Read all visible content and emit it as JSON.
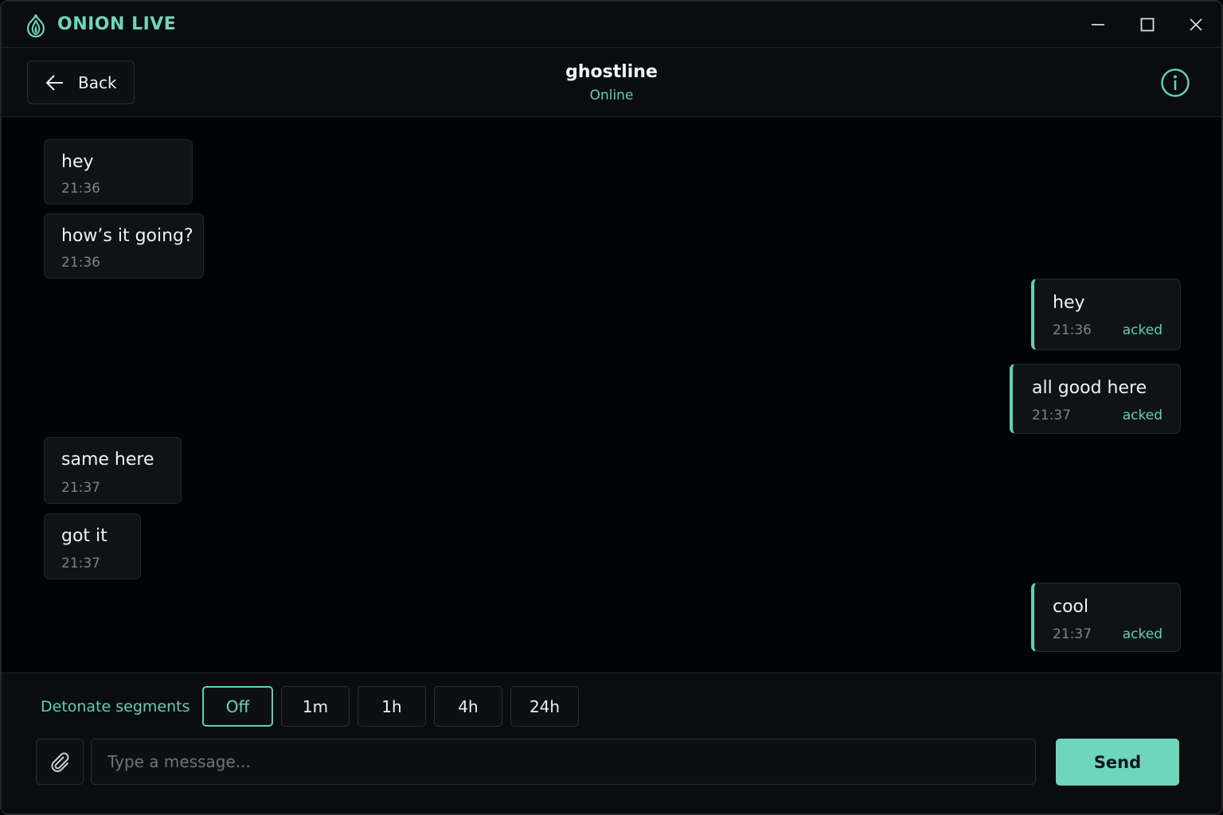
{
  "app": {
    "title": "ONION LIVE",
    "logo_icon": "onion-icon",
    "accent_color": "#5fd1b4"
  },
  "window_controls": [
    "minimize-icon",
    "maximize-icon",
    "close-icon"
  ],
  "header": {
    "back_label": "Back",
    "contact_name": "ghostline",
    "contact_status": "Online",
    "info_icon": "info-icon"
  },
  "messages": [
    {
      "direction": "in",
      "text": "hey",
      "time": "21:36"
    },
    {
      "direction": "in",
      "text": "how’s it going?",
      "time": "21:36"
    },
    {
      "direction": "out",
      "text": "hey",
      "time": "21:36",
      "status": "acked"
    },
    {
      "direction": "out",
      "text": "all good here",
      "time": "21:37",
      "status": "acked"
    },
    {
      "direction": "in",
      "text": "same here",
      "time": "21:37"
    },
    {
      "direction": "in",
      "text": "got it",
      "time": "21:37"
    },
    {
      "direction": "out",
      "text": "cool",
      "time": "21:37",
      "status": "acked"
    }
  ],
  "composer": {
    "detonate_label": "Detonate segments",
    "segments": [
      "Off",
      "1m",
      "1h",
      "4h",
      "24h"
    ],
    "selected_segment": "Off",
    "attach_icon": "paperclip-icon",
    "input_value": "",
    "input_placeholder": "Type a message...",
    "send_label": "Send"
  }
}
